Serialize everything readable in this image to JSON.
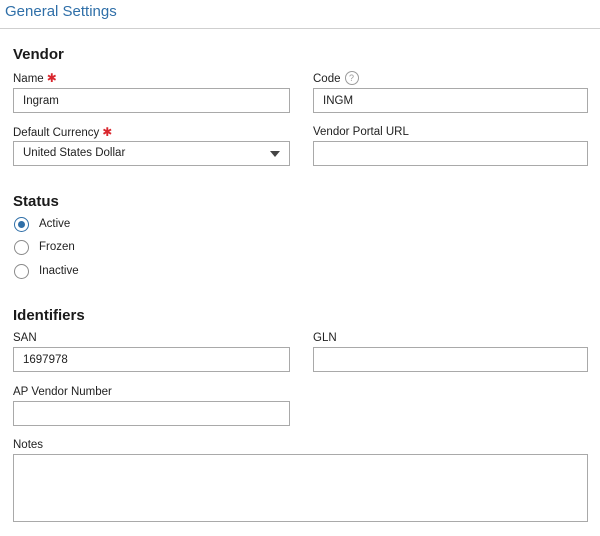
{
  "header": {
    "title": "General Settings"
  },
  "vendor": {
    "section_title": "Vendor",
    "name": {
      "label": "Name",
      "value": "Ingram",
      "required": true
    },
    "code": {
      "label": "Code",
      "value": "INGM",
      "help": "?"
    },
    "default_currency": {
      "label": "Default Currency",
      "value": "United States Dollar",
      "required": true
    },
    "portal_url": {
      "label": "Vendor Portal URL",
      "value": ""
    }
  },
  "status": {
    "section_title": "Status",
    "options": [
      {
        "label": "Active",
        "checked": true
      },
      {
        "label": "Frozen",
        "checked": false
      },
      {
        "label": "Inactive",
        "checked": false
      }
    ]
  },
  "identifiers": {
    "section_title": "Identifiers",
    "san": {
      "label": "SAN",
      "value": "1697978"
    },
    "gln": {
      "label": "GLN",
      "value": ""
    },
    "ap_vendor_number": {
      "label": "AP Vendor Number",
      "value": ""
    }
  },
  "notes": {
    "label": "Notes",
    "value": ""
  },
  "colors": {
    "accent": "#2f6fa8",
    "required": "#d9272e",
    "border": "#a9a9a9"
  },
  "required_mark": "✱"
}
